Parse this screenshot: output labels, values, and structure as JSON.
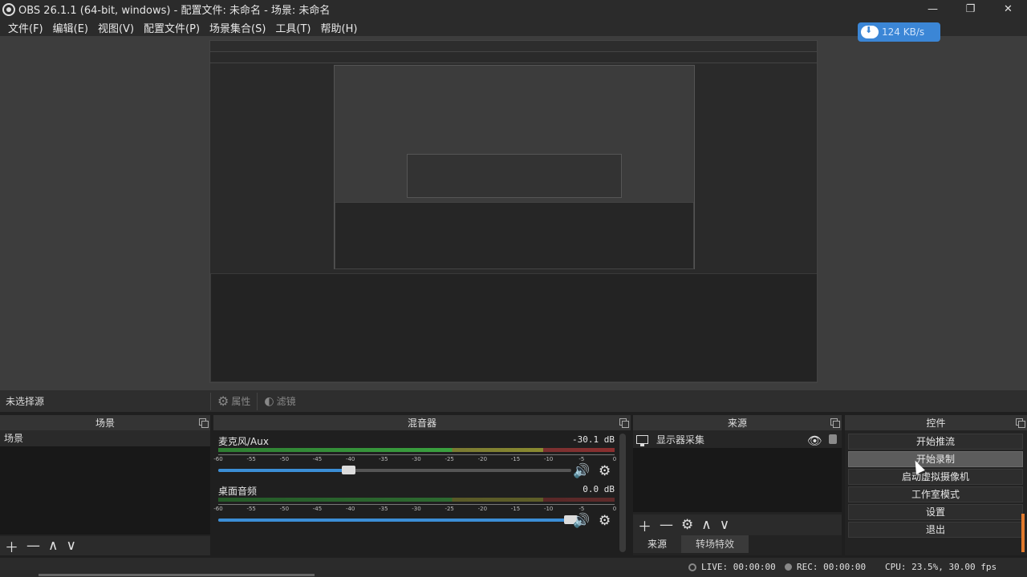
{
  "window": {
    "title": "OBS 26.1.1 (64-bit, windows) - 配置文件: 未命名 - 场景: 未命名",
    "minimize": "—",
    "maximize": "❐",
    "close": "✕"
  },
  "menu": [
    "文件(F)",
    "编辑(E)",
    "视图(V)",
    "配置文件(P)",
    "场景集合(S)",
    "工具(T)",
    "帮助(H)"
  ],
  "download_badge": {
    "speed": "124 KB/s",
    "color": "#3b86d6"
  },
  "source_toolbar": {
    "no_source": "未选择源",
    "properties": "属性",
    "filters": "滤镜"
  },
  "scenes": {
    "title": "场景",
    "items": [
      "场景"
    ]
  },
  "mixer": {
    "title": "混音器",
    "channels": [
      {
        "name": "麦克风/Aux",
        "db": "-30.1 dB",
        "volume": 0.37
      },
      {
        "name": "桌面音频",
        "db": "0.0 dB",
        "volume": 1.0
      }
    ],
    "tick_labels": [
      "-60",
      "-55",
      "-50",
      "-45",
      "-40",
      "-35",
      "-30",
      "-25",
      "-20",
      "-15",
      "-10",
      "-5",
      "0"
    ]
  },
  "sources": {
    "title": "来源",
    "items": [
      "显示器采集"
    ],
    "tabs": [
      "来源",
      "转场特效"
    ]
  },
  "controls": {
    "title": "控件",
    "buttons": [
      "开始推流",
      "开始录制",
      "启动虚拟摄像机",
      "工作室模式",
      "设置",
      "退出"
    ]
  },
  "status": {
    "live": "LIVE: 00:00:00",
    "rec": "REC: 00:00:00",
    "cpu": "CPU: 23.5%, 30.00 fps"
  },
  "icons": {
    "add": "＋",
    "remove": "—",
    "up": "∧",
    "down": "∨",
    "gear": "⚙",
    "speaker": "🔊",
    "eye": "👁"
  }
}
